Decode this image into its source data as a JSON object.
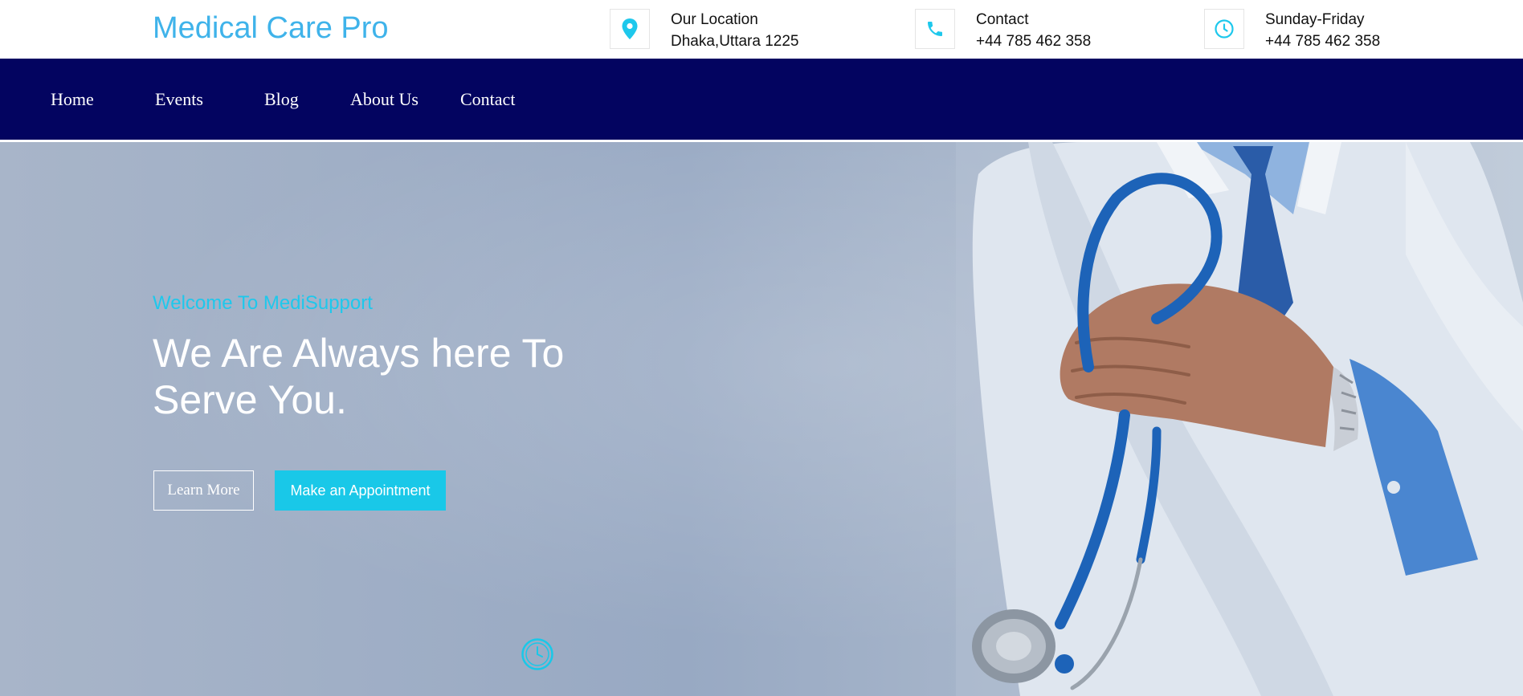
{
  "header": {
    "brand": "Medical Care Pro",
    "location": {
      "label": "Our Location",
      "value": "Dhaka,Uttara 1225",
      "icon": "map-pin-icon"
    },
    "contact": {
      "label": "Contact",
      "value": "+44 785 462 358",
      "icon": "phone-icon"
    },
    "hours": {
      "label": "Sunday-Friday",
      "value": "+44 785 462 358",
      "icon": "clock-icon"
    }
  },
  "nav": {
    "items": [
      {
        "label": "Home"
      },
      {
        "label": "Events"
      },
      {
        "label": "Blog"
      },
      {
        "label": "About Us"
      },
      {
        "label": "Contact"
      }
    ]
  },
  "hero": {
    "kicker": "Welcome To MediSupport",
    "headline": "We Are Always here To Serve You.",
    "learn_more": "Learn More",
    "appointment": "Make an Appointment"
  },
  "colors": {
    "brand": "#3fb3ea",
    "accent": "#19c8e8",
    "navbar": "#030460",
    "hero_bg": "#a3b2c8"
  }
}
